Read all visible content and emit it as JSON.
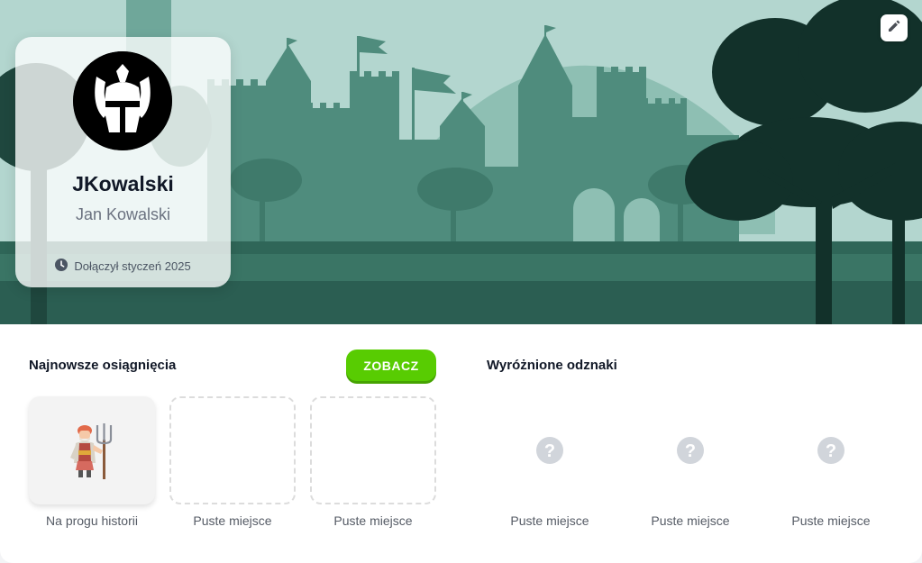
{
  "profile": {
    "username": "JKowalski",
    "full_name": "Jan Kowalski",
    "joined": "Dołączył styczeń 2025"
  },
  "icons": {
    "edit": "pencil-icon",
    "clock": "clock-icon",
    "avatar": "knight-helmet-icon",
    "achievement": "peasant-pitchfork-icon",
    "badge_placeholder": "question-mark-icon"
  },
  "achievements": {
    "title": "Najnowsze osiągnięcia",
    "see_all_label": "ZOBACZ",
    "items": [
      {
        "label": "Na progu historii"
      },
      {
        "label": "Puste miejsce"
      },
      {
        "label": "Puste miejsce"
      }
    ]
  },
  "badges": {
    "title": "Wyróżnione odznaki",
    "items": [
      {
        "label": "Puste miejsce"
      },
      {
        "label": "Puste miejsce"
      },
      {
        "label": "Puste miejsce"
      }
    ]
  },
  "colors": {
    "accent_green": "#58cc02",
    "banner_sky": "#b3d6cf",
    "castle": "#4d8b7c",
    "trees_dark": "#12312a"
  }
}
